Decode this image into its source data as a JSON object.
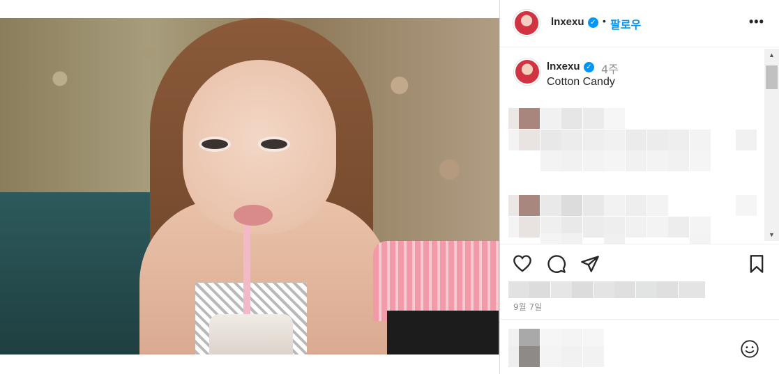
{
  "post": {
    "username": "lnxexu",
    "verified_mark": "✓",
    "dot": "•",
    "follow_label": "팔로우",
    "more_label": "•••",
    "caption_time": "4주",
    "caption_text": "Cotton Candy",
    "date": "9월 7일"
  },
  "icons": {
    "heart": "heart-icon",
    "comment": "comment-icon",
    "share": "share-icon",
    "save": "bookmark-icon",
    "emoji": "emoji-icon"
  },
  "colors": {
    "accent": "#0095f6",
    "text": "#262626",
    "muted": "#8e8e8e"
  }
}
